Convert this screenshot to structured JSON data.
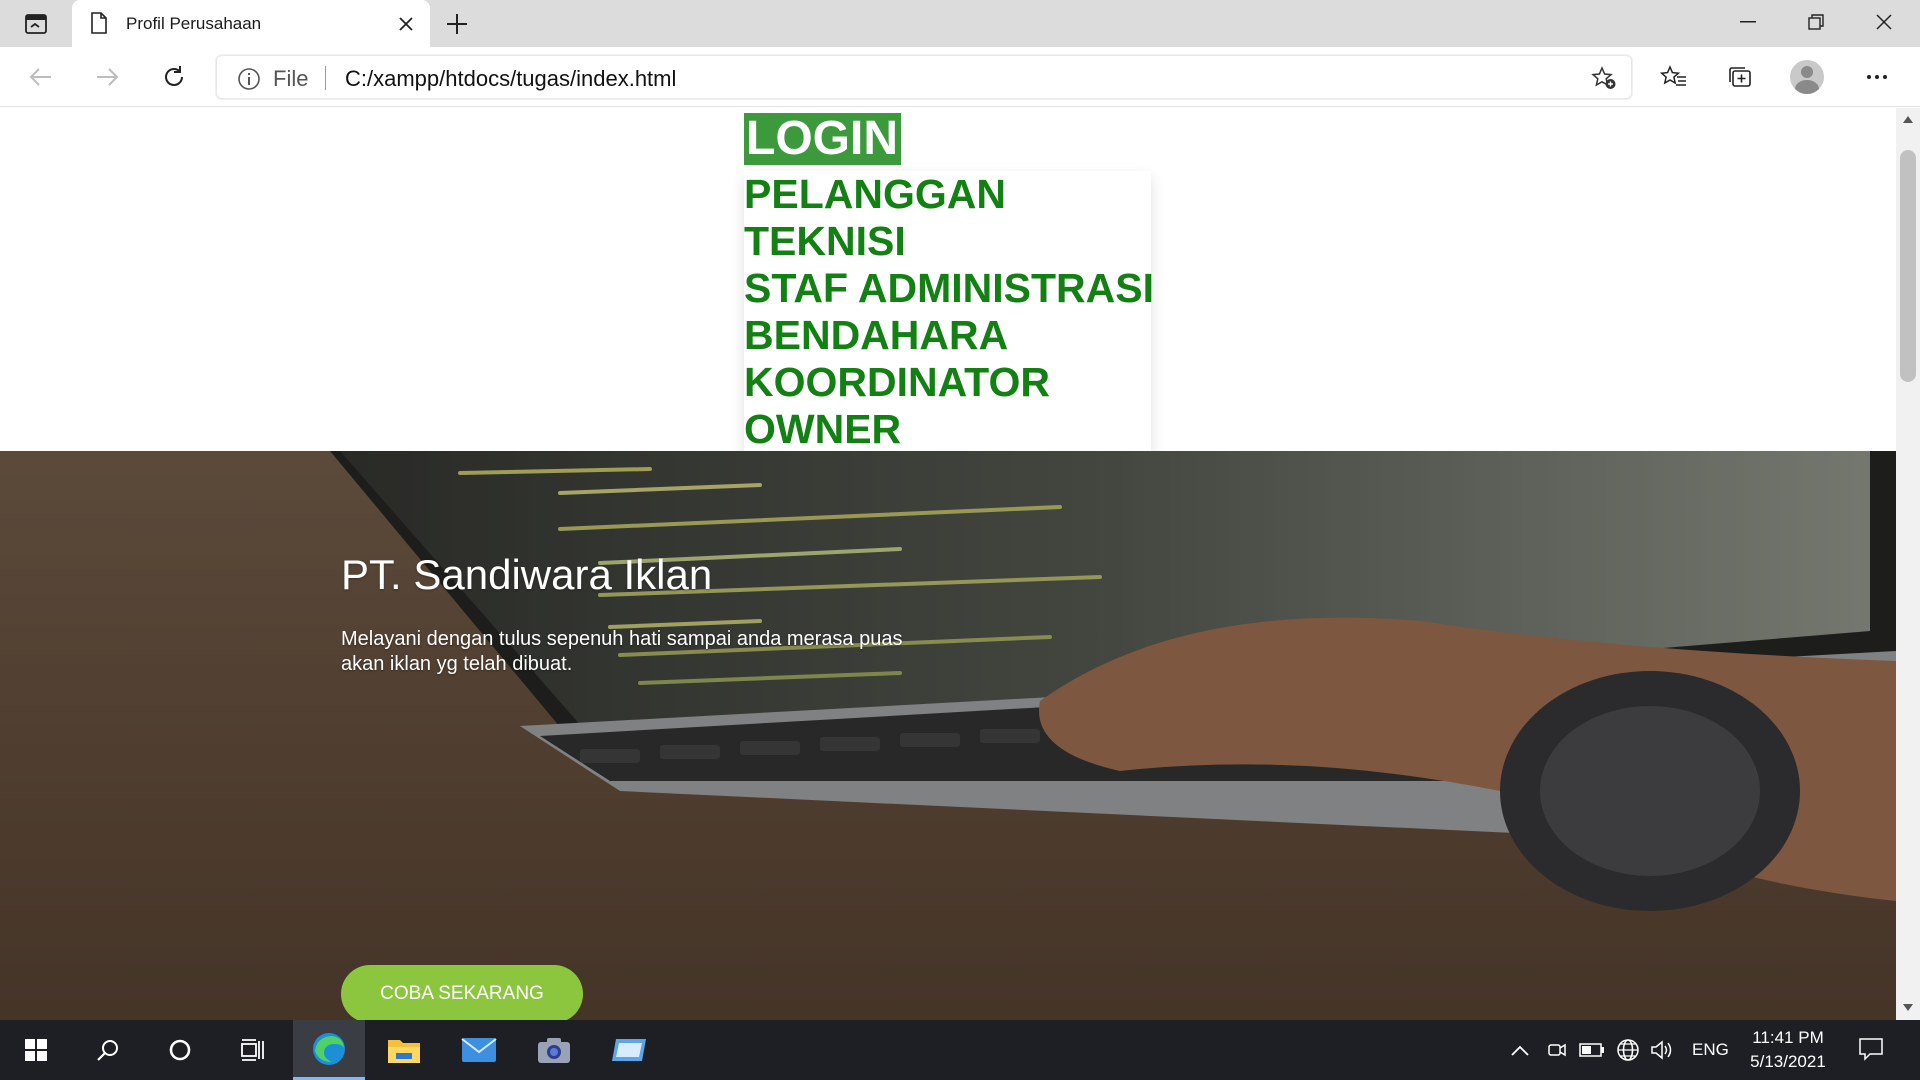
{
  "browser": {
    "tab_title": "Profil Perusahaan",
    "address_prefix": "File",
    "url": "C:/xampp/htdocs/tugas/index.html"
  },
  "page": {
    "menu": {
      "login": "LOGIN",
      "items": [
        "PELANGGAN",
        "TEKNISI",
        "STAF ADMINISTRASI",
        "BENDAHARA",
        "KOORDINATOR",
        "OWNER"
      ]
    },
    "hero": {
      "title": "PT. Sandiwara Iklan",
      "description": "Melayani dengan tulus sepenuh hati sampai anda merasa puas akan iklan yg telah dibuat.",
      "cta": "COBA SEKARANG"
    }
  },
  "taskbar": {
    "language": "ENG",
    "time": "11:41 PM",
    "date": "5/13/2021"
  },
  "colors": {
    "login_bg": "#3c9a3c",
    "menu_text": "#138013",
    "cta_bg": "#8cc63f"
  }
}
